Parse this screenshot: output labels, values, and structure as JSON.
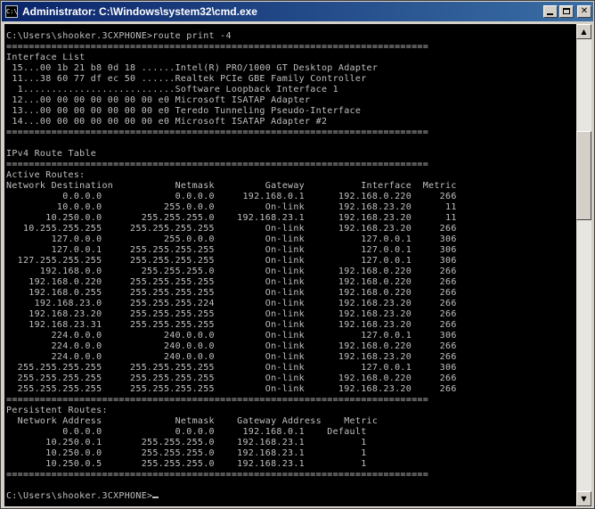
{
  "window": {
    "title": "Administrator: C:\\Windows\\system32\\cmd.exe",
    "icon_label": "C:\\",
    "colors": {
      "titlebar_start": "#0a246a",
      "titlebar_end": "#3a6ea5",
      "console_bg": "#000000",
      "console_fg": "#c0c0c0"
    }
  },
  "titlebar_buttons": {
    "minimize": "minimize-icon",
    "maximize": "maximize-icon",
    "close": "close-icon",
    "close_glyph": "✕"
  },
  "scrollbar": {
    "up_arrow": "▲",
    "down_arrow": "▼"
  },
  "console": {
    "prompt": "C:\\Users\\shooker.3CXPHONE>",
    "command": "route print -4",
    "separator": "===========================================================================",
    "interface_list": {
      "heading": "Interface List",
      "entries": [
        " 15...00 1b 21 b8 0d 18 ......Intel(R) PRO/1000 GT Desktop Adapter",
        " 11...38 60 77 df ec 50 ......Realtek PCIe GBE Family Controller",
        "  1...........................Software Loopback Interface 1",
        " 12...00 00 00 00 00 00 00 e0 Microsoft ISATAP Adapter",
        " 13...00 00 00 00 00 00 00 e0 Teredo Tunneling Pseudo-Interface",
        " 14...00 00 00 00 00 00 00 e0 Microsoft ISATAP Adapter #2"
      ]
    },
    "ipv4_heading": "IPv4 Route Table",
    "active_routes": {
      "heading": "Active Routes:",
      "columns": [
        "Network Destination",
        "Netmask",
        "Gateway",
        "Interface",
        "Metric"
      ],
      "rows": [
        [
          "0.0.0.0",
          "0.0.0.0",
          "192.168.0.1",
          "192.168.0.220",
          "266"
        ],
        [
          "10.0.0.0",
          "255.0.0.0",
          "On-link",
          "192.168.23.20",
          "11"
        ],
        [
          "10.250.0.0",
          "255.255.255.0",
          "192.168.23.1",
          "192.168.23.20",
          "11"
        ],
        [
          "10.255.255.255",
          "255.255.255.255",
          "On-link",
          "192.168.23.20",
          "266"
        ],
        [
          "127.0.0.0",
          "255.0.0.0",
          "On-link",
          "127.0.0.1",
          "306"
        ],
        [
          "127.0.0.1",
          "255.255.255.255",
          "On-link",
          "127.0.0.1",
          "306"
        ],
        [
          "127.255.255.255",
          "255.255.255.255",
          "On-link",
          "127.0.0.1",
          "306"
        ],
        [
          "192.168.0.0",
          "255.255.255.0",
          "On-link",
          "192.168.0.220",
          "266"
        ],
        [
          "192.168.0.220",
          "255.255.255.255",
          "On-link",
          "192.168.0.220",
          "266"
        ],
        [
          "192.168.0.255",
          "255.255.255.255",
          "On-link",
          "192.168.0.220",
          "266"
        ],
        [
          "192.168.23.0",
          "255.255.255.224",
          "On-link",
          "192.168.23.20",
          "266"
        ],
        [
          "192.168.23.20",
          "255.255.255.255",
          "On-link",
          "192.168.23.20",
          "266"
        ],
        [
          "192.168.23.31",
          "255.255.255.255",
          "On-link",
          "192.168.23.20",
          "266"
        ],
        [
          "224.0.0.0",
          "240.0.0.0",
          "On-link",
          "127.0.0.1",
          "306"
        ],
        [
          "224.0.0.0",
          "240.0.0.0",
          "On-link",
          "192.168.0.220",
          "266"
        ],
        [
          "224.0.0.0",
          "240.0.0.0",
          "On-link",
          "192.168.23.20",
          "266"
        ],
        [
          "255.255.255.255",
          "255.255.255.255",
          "On-link",
          "127.0.0.1",
          "306"
        ],
        [
          "255.255.255.255",
          "255.255.255.255",
          "On-link",
          "192.168.0.220",
          "266"
        ],
        [
          "255.255.255.255",
          "255.255.255.255",
          "On-link",
          "192.168.23.20",
          "266"
        ]
      ]
    },
    "persistent_routes": {
      "heading": "Persistent Routes:",
      "columns": [
        "Network Address",
        "Netmask",
        "Gateway Address",
        "Metric"
      ],
      "rows": [
        [
          "0.0.0.0",
          "0.0.0.0",
          "192.168.0.1",
          "Default"
        ],
        [
          "10.250.0.1",
          "255.255.255.0",
          "192.168.23.1",
          "1"
        ],
        [
          "10.250.0.0",
          "255.255.255.0",
          "192.168.23.1",
          "1"
        ],
        [
          "10.250.0.5",
          "255.255.255.0",
          "192.168.23.1",
          "1"
        ]
      ]
    }
  }
}
